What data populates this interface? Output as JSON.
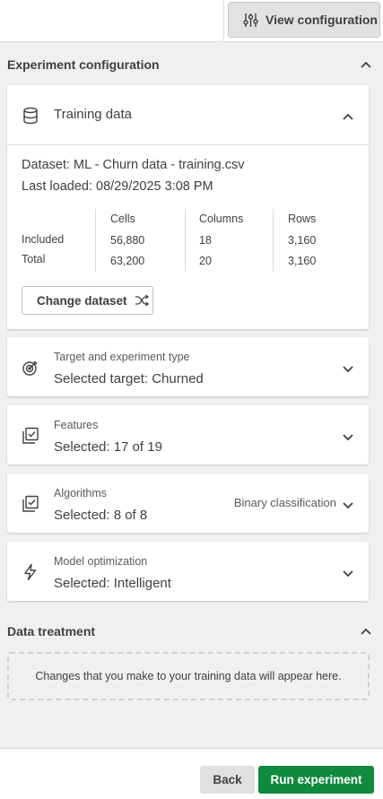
{
  "toolbar": {
    "view_configuration_label": "View configuration",
    "view_configuration_icon": "sliders-icon"
  },
  "experiment_configuration": {
    "title": "Experiment configuration",
    "expanded": true,
    "training_data": {
      "title": "Training data",
      "icon": "database-icon",
      "expanded": true,
      "dataset_line": "Dataset: ML - Churn data - training.csv",
      "last_loaded_line": "Last loaded: 08/29/2025 3:08 PM",
      "stats": {
        "columns": [
          "Cells",
          "Columns",
          "Rows"
        ],
        "rows": [
          {
            "label": "Included",
            "values": [
              "56,880",
              "18",
              "3,160"
            ]
          },
          {
            "label": "Total",
            "values": [
              "63,200",
              "20",
              "3,160"
            ]
          }
        ]
      },
      "change_dataset_label": "Change dataset",
      "change_dataset_icon": "shuffle-icon"
    },
    "sections": [
      {
        "label": "Target and experiment type",
        "value": "Selected target: Churned",
        "icon": "target-icon",
        "extra": ""
      },
      {
        "label": "Features",
        "value": "Selected: 17 of 19",
        "icon": "checklist-icon",
        "extra": ""
      },
      {
        "label": "Algorithms",
        "value": "Selected: 8 of 8",
        "icon": "checklist-icon",
        "extra": "Binary classification"
      },
      {
        "label": "Model optimization",
        "value": "Selected: Intelligent",
        "icon": "lightning-icon",
        "extra": ""
      }
    ]
  },
  "data_treatment": {
    "title": "Data treatment",
    "expanded": true,
    "placeholder": "Changes that you make to your training data will appear here."
  },
  "footer": {
    "back_label": "Back",
    "run_label": "Run experiment",
    "run_color": "#108a3e"
  }
}
